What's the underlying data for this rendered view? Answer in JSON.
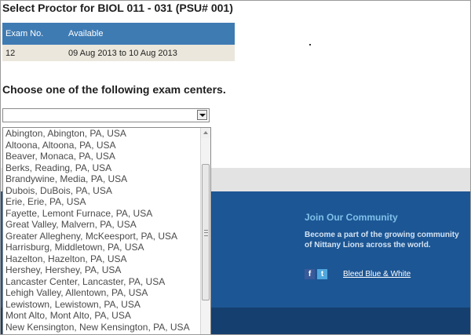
{
  "page": {
    "title": "Select Proctor for BIOL 011 - 031 (PSU# 001)",
    "subtitle": "Choose one of the following exam centers."
  },
  "exam_table": {
    "headers": [
      "Exam No.",
      "Available"
    ],
    "rows": [
      [
        "12",
        "09 Aug 2013 to 10 Aug 2013"
      ]
    ]
  },
  "exam_center_select": {
    "selected_value": "",
    "options": [
      "Abington, Abington, PA, USA",
      "Altoona, Altoona, PA, USA",
      "Beaver, Monaca, PA, USA",
      "Berks, Reading, PA, USA",
      "Brandywine, Media, PA, USA",
      "Dubois, DuBois, PA, USA",
      "Erie, Erie, PA, USA",
      "Fayette, Lemont Furnace, PA, USA",
      "Great Valley, Malvern, PA, USA",
      "Greater Allegheny, McKeesport, PA, USA",
      "Harrisburg, Middletown, PA, USA",
      "Hazelton, Hazelton, PA, USA",
      "Hershey, Hershey, PA, USA",
      "Lancaster Center, Lancaster, PA, USA",
      "Lehigh Valley, Allentown, PA, USA",
      "Lewistown, Lewistown, PA, USA",
      "Mont Alto, Mont Alto, PA, USA",
      "New Kensington, New Kensington, PA, USA"
    ]
  },
  "footer": {
    "community_title": "Join Our Community",
    "community_text": "Become a part of the growing community of Nittany Lions across the world.",
    "facebook_glyph": "f",
    "twitter_glyph": "t",
    "link_label": "Bleed Blue & White"
  },
  "icons": [
    "chevron-down-icon",
    "facebook-icon",
    "twitter-icon",
    "scroll-up-icon",
    "scroll-grip-icon"
  ],
  "colors": {
    "table_header": "#3f7bb3",
    "table_row": "#ebe7dc",
    "footer_blue": "#1d5694",
    "footer_dark": "#153f6e",
    "community_title": "#7fc0ea"
  }
}
